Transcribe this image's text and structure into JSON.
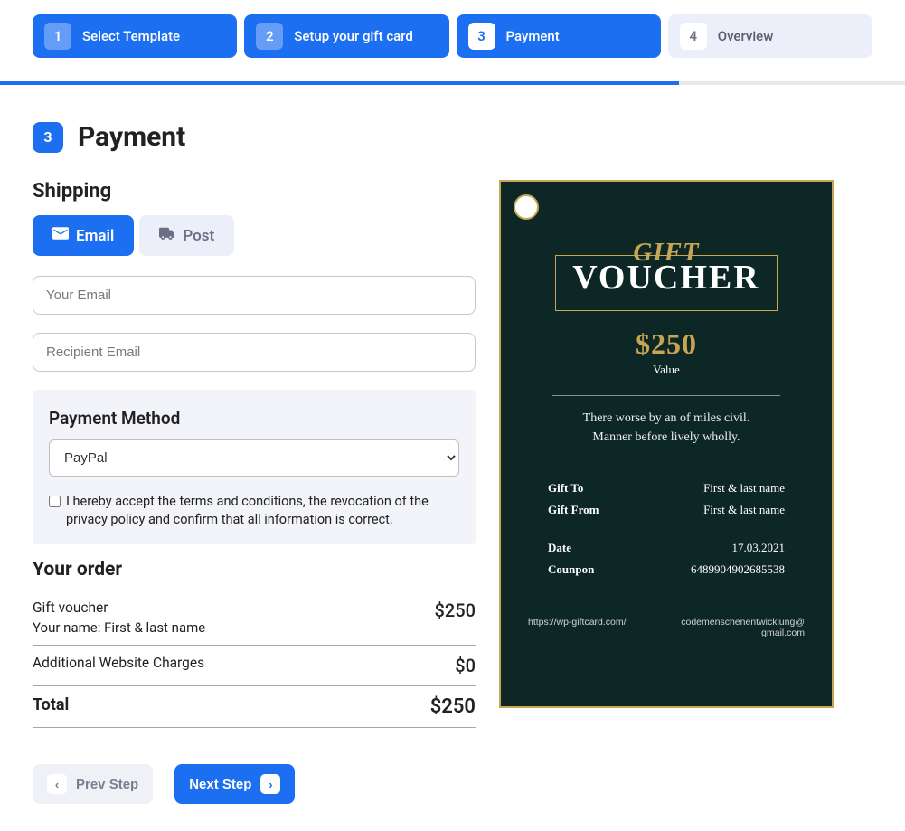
{
  "stepper": {
    "steps": [
      {
        "num": "1",
        "label": "Select Template",
        "state": "active"
      },
      {
        "num": "2",
        "label": "Setup your gift card",
        "state": "active"
      },
      {
        "num": "3",
        "label": "Payment",
        "state": "current"
      },
      {
        "num": "4",
        "label": "Overview",
        "state": "inactive"
      }
    ]
  },
  "page": {
    "badge": "3",
    "title": "Payment"
  },
  "shipping": {
    "title": "Shipping",
    "tabs": {
      "email": "Email",
      "post": "Post"
    },
    "your_email_placeholder": "Your Email",
    "your_email_value": "",
    "recipient_email_placeholder": "Recipient Email",
    "recipient_email_value": ""
  },
  "payment": {
    "title": "Payment Method",
    "selected": "PayPal",
    "terms": "I hereby accept the terms and conditions, the revocation of the privacy policy and confirm that all information is correct."
  },
  "order": {
    "title": "Your order",
    "rows": {
      "voucher_label": "Gift voucher",
      "voucher_amount": "$250",
      "your_name_label": "Your name: First & last name",
      "additional_label": "Additional Website Charges",
      "additional_amount": "$0",
      "total_label": "Total",
      "total_amount": "$250"
    }
  },
  "nav": {
    "prev": "Prev Step",
    "next": "Next Step"
  },
  "voucher": {
    "gift": "GIFT",
    "word": "VOUCHER",
    "amount": "$250",
    "value_label": "Value",
    "tagline1": "There worse by an of miles civil.",
    "tagline2": "Manner before lively wholly.",
    "gift_to_k": "Gift To",
    "gift_to_v": "First & last name",
    "gift_from_k": "Gift From",
    "gift_from_v": "First & last name",
    "date_k": "Date",
    "date_v": "17.03.2021",
    "coupon_k": "Counpon",
    "coupon_v": "6489904902685538",
    "footer_left": "https://wp-giftcard.com/",
    "footer_right1": "codemenschenentwicklung@",
    "footer_right2": "gmail.com"
  }
}
